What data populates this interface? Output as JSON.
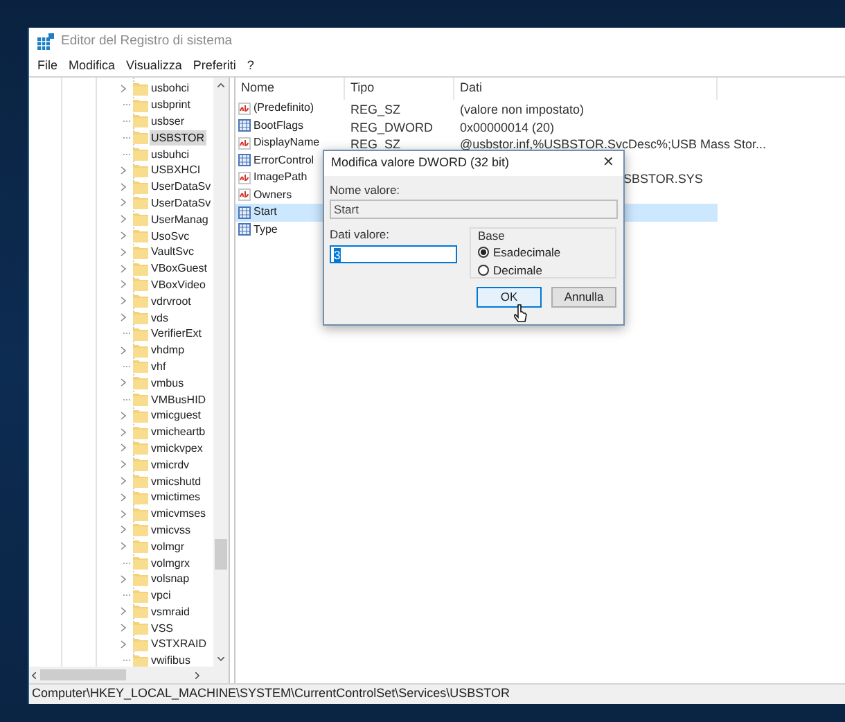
{
  "window": {
    "title": "Editor del Registro di sistema"
  },
  "menu": [
    "File",
    "Modifica",
    "Visualizza",
    "Preferiti",
    "?"
  ],
  "tree": [
    {
      "label": "usbohci",
      "has_children": true,
      "selected": false
    },
    {
      "label": "usbprint",
      "has_children": false,
      "selected": false
    },
    {
      "label": "usbser",
      "has_children": false,
      "selected": false
    },
    {
      "label": "USBSTOR",
      "has_children": false,
      "selected": true
    },
    {
      "label": "usbuhci",
      "has_children": false,
      "selected": false
    },
    {
      "label": "USBXHCI",
      "has_children": true,
      "selected": false
    },
    {
      "label": "UserDataSv",
      "has_children": true,
      "selected": false
    },
    {
      "label": "UserDataSv",
      "has_children": true,
      "selected": false
    },
    {
      "label": "UserManag",
      "has_children": true,
      "selected": false
    },
    {
      "label": "UsoSvc",
      "has_children": true,
      "selected": false
    },
    {
      "label": "VaultSvc",
      "has_children": true,
      "selected": false
    },
    {
      "label": "VBoxGuest",
      "has_children": true,
      "selected": false
    },
    {
      "label": "VBoxVideo",
      "has_children": true,
      "selected": false
    },
    {
      "label": "vdrvroot",
      "has_children": true,
      "selected": false
    },
    {
      "label": "vds",
      "has_children": true,
      "selected": false
    },
    {
      "label": "VerifierExt",
      "has_children": false,
      "selected": false
    },
    {
      "label": "vhdmp",
      "has_children": true,
      "selected": false
    },
    {
      "label": "vhf",
      "has_children": false,
      "selected": false
    },
    {
      "label": "vmbus",
      "has_children": true,
      "selected": false
    },
    {
      "label": "VMBusHID",
      "has_children": false,
      "selected": false
    },
    {
      "label": "vmicguest",
      "has_children": true,
      "selected": false
    },
    {
      "label": "vmicheartb",
      "has_children": true,
      "selected": false
    },
    {
      "label": "vmickvpex",
      "has_children": true,
      "selected": false
    },
    {
      "label": "vmicrdv",
      "has_children": true,
      "selected": false
    },
    {
      "label": "vmicshutd",
      "has_children": true,
      "selected": false
    },
    {
      "label": "vmictimes",
      "has_children": true,
      "selected": false
    },
    {
      "label": "vmicvmses",
      "has_children": true,
      "selected": false
    },
    {
      "label": "vmicvss",
      "has_children": true,
      "selected": false
    },
    {
      "label": "volmgr",
      "has_children": true,
      "selected": false
    },
    {
      "label": "volmgrx",
      "has_children": false,
      "selected": false
    },
    {
      "label": "volsnap",
      "has_children": true,
      "selected": false
    },
    {
      "label": "vpci",
      "has_children": false,
      "selected": false
    },
    {
      "label": "vsmraid",
      "has_children": true,
      "selected": false
    },
    {
      "label": "VSS",
      "has_children": true,
      "selected": false
    },
    {
      "label": "VSTXRAID",
      "has_children": true,
      "selected": false
    },
    {
      "label": "vwifibus",
      "has_children": false,
      "selected": false
    }
  ],
  "list": {
    "columns": [
      "Nome",
      "Tipo",
      "Dati"
    ],
    "rows": [
      {
        "nome": "(Predefinito)",
        "kind": "string",
        "tipo": "REG_SZ",
        "dati": "(valore non impostato)",
        "selected": false
      },
      {
        "nome": "BootFlags",
        "kind": "dword",
        "tipo": "REG_DWORD",
        "dati": "0x00000014 (20)",
        "selected": false
      },
      {
        "nome": "DisplayName",
        "kind": "string",
        "tipo": "REG_SZ",
        "dati": "@usbstor.inf,%USBSTOR.SvcDesc%;USB Mass Stor...",
        "selected": false
      },
      {
        "nome": "ErrorControl",
        "kind": "dword",
        "selected": false
      },
      {
        "nome": "ImagePath",
        "kind": "string",
        "dati": "SBSTOR.SYS",
        "selected": false
      },
      {
        "nome": "Owners",
        "kind": "string",
        "selected": false
      },
      {
        "nome": "Start",
        "kind": "dword",
        "selected": true
      },
      {
        "nome": "Type",
        "kind": "dword",
        "selected": false
      }
    ]
  },
  "status_bar": "Computer\\HKEY_LOCAL_MACHINE\\SYSTEM\\CurrentControlSet\\Services\\USBSTOR",
  "dialog": {
    "title": "Modifica valore DWORD (32 bit)",
    "close": "✕",
    "name_label": "Nome valore:",
    "name_value": "Start",
    "data_label": "Dati valore:",
    "data_value": "3",
    "data_value_selected": true,
    "base_label": "Base",
    "base_options": [
      {
        "label": "Esadecimale",
        "selected": true
      },
      {
        "label": "Decimale",
        "selected": false
      }
    ],
    "buttons": [
      {
        "label": "OK",
        "focused": true
      },
      {
        "label": "Annulla",
        "focused": false
      }
    ]
  }
}
